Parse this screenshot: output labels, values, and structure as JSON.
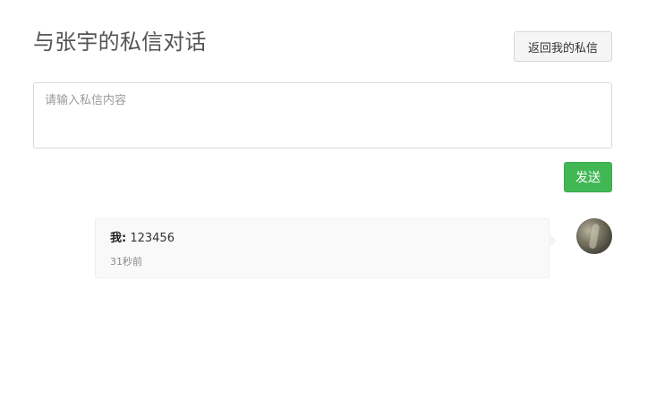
{
  "header": {
    "title": "与张宇的私信对话",
    "back_label": "返回我的私信"
  },
  "composer": {
    "placeholder": "请输入私信内容",
    "value": "",
    "send_label": "发送"
  },
  "messages": [
    {
      "sender": "我:",
      "text": "123456",
      "time": "31秒前",
      "avatar": "user-avatar"
    }
  ]
}
